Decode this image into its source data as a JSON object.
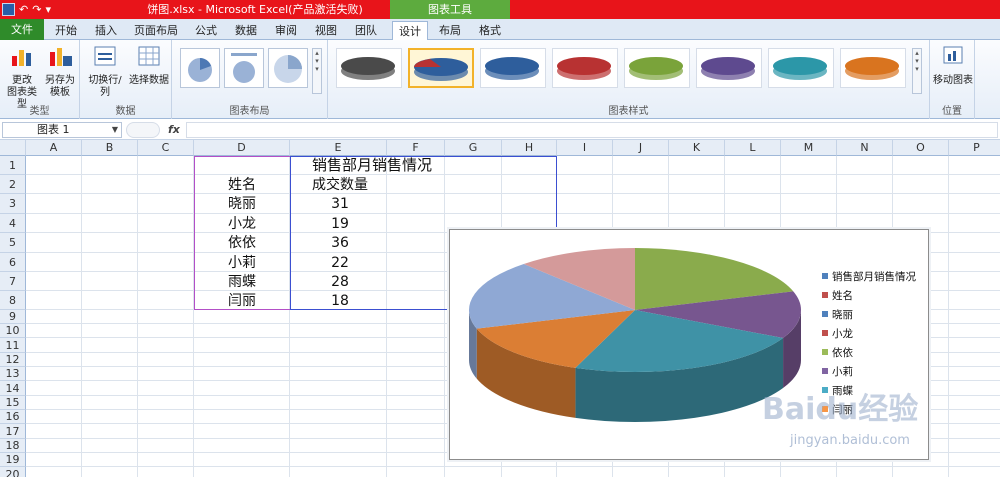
{
  "window": {
    "title": "饼图.xlsx - Microsoft Excel(产品激活失败)",
    "context_tab": "图表工具"
  },
  "ribbon_tabs": [
    "文件",
    "开始",
    "插入",
    "页面布局",
    "公式",
    "数据",
    "审阅",
    "视图",
    "团队",
    "设计",
    "布局",
    "格式"
  ],
  "active_tab": "设计",
  "ribbon": {
    "groups": {
      "type": "类型",
      "data": "数据",
      "layout": "图表布局",
      "styles": "图表样式",
      "location": "位置"
    },
    "buttons": {
      "change_type_1": "更改",
      "change_type_2": "图表类型",
      "save_template_1": "另存为",
      "save_template_2": "模板",
      "switch_rowcol": "切换行/列",
      "select_data": "选择数据",
      "move_chart": "移动图表"
    },
    "style_colors": [
      "#4a4a4a",
      "#2e5e9c",
      "#2e5e9c",
      "#b83232",
      "#7aa33a",
      "#5e4a8f",
      "#2c97a8",
      "#d9741f"
    ]
  },
  "formula_bar": {
    "name_box": "图表 1",
    "fx": "fx",
    "value": ""
  },
  "columns": [
    "A",
    "B",
    "C",
    "D",
    "E",
    "F",
    "G",
    "H",
    "I",
    "J",
    "K",
    "L",
    "M",
    "N",
    "O",
    "P"
  ],
  "rows": [
    "1",
    "2",
    "3",
    "4",
    "5",
    "6",
    "7",
    "8",
    "9",
    "10",
    "11",
    "12",
    "13",
    "14",
    "15",
    "16",
    "17",
    "18",
    "19",
    "20"
  ],
  "sheet": {
    "title": "销售部月销售情况",
    "header_name": "姓名",
    "header_qty": "成交数量",
    "records": [
      {
        "name": "晓丽",
        "qty": "31"
      },
      {
        "name": "小龙",
        "qty": "19"
      },
      {
        "name": "依依",
        "qty": "36"
      },
      {
        "name": "小莉",
        "qty": "22"
      },
      {
        "name": "雨蝶",
        "qty": "28"
      },
      {
        "name": "闫丽",
        "qty": "18"
      }
    ]
  },
  "chart_data": {
    "type": "pie",
    "title": "",
    "categories": [
      "晓丽",
      "小龙",
      "依依",
      "小莉",
      "雨蝶",
      "闫丽"
    ],
    "values": [
      31,
      19,
      36,
      22,
      28,
      18
    ],
    "colors": [
      "#4f81bd",
      "#c0504d",
      "#9bbb59",
      "#8064a2",
      "#4bacc6",
      "#f79646"
    ],
    "slice_colors": [
      "#8aab4c",
      "#77568f",
      "#3f92a6",
      "#db7e34",
      "#8fa8d4",
      "#d49a9a"
    ],
    "legend": [
      "销售部月销售情况",
      "姓名",
      "晓丽",
      "小龙",
      "依依",
      "小莉",
      "雨蝶",
      "闫丽"
    ],
    "legend_position": "right",
    "style": "3d"
  },
  "watermark": {
    "main": "Baidu经验",
    "sub": "jingyan.baidu.com"
  }
}
